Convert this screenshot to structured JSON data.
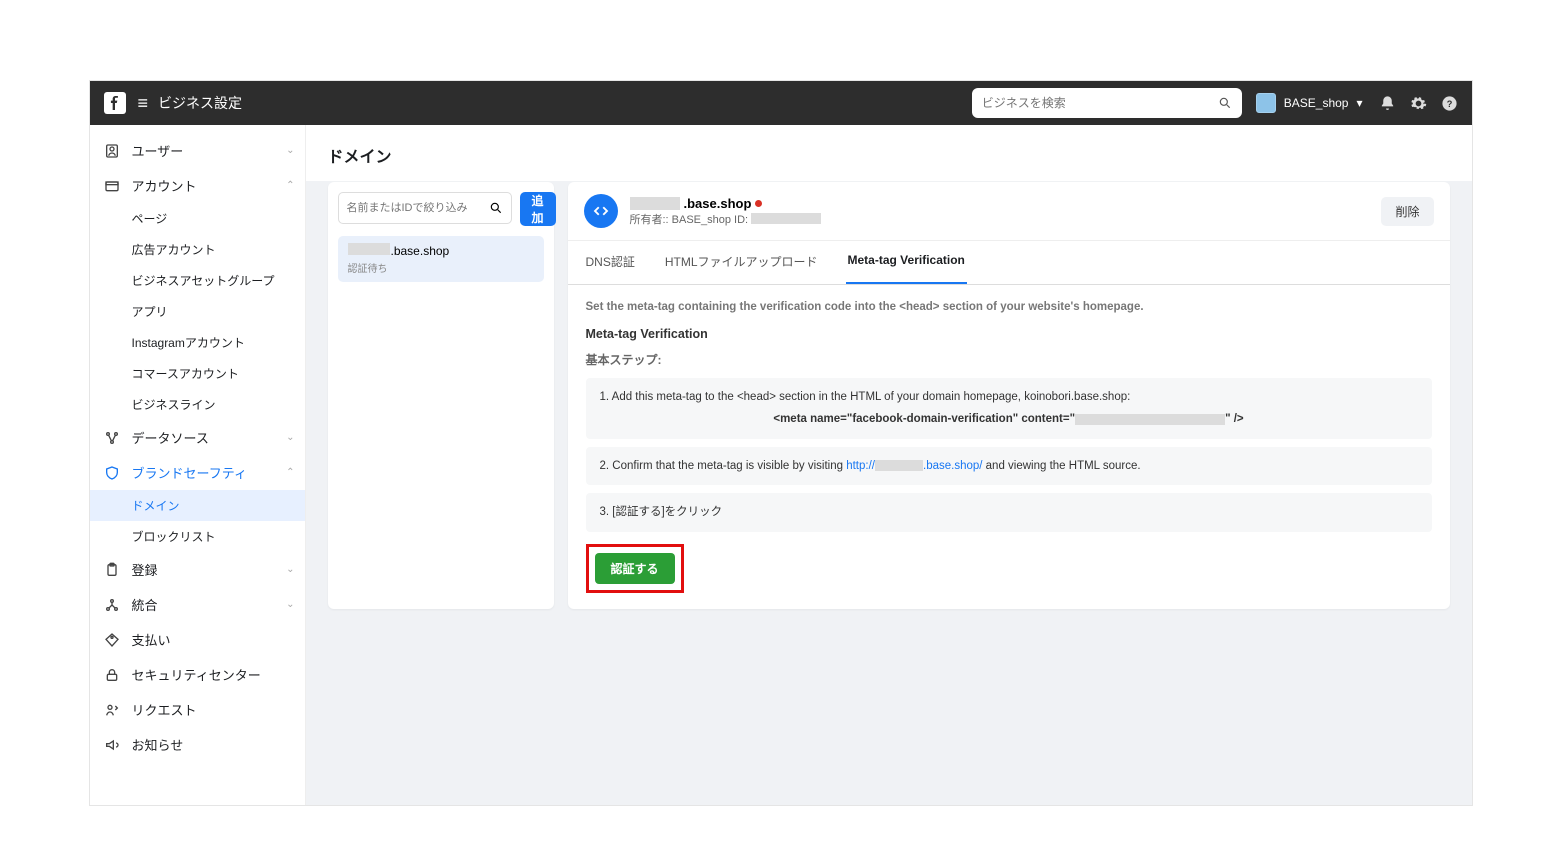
{
  "topbar": {
    "title": "ビジネス設定",
    "search_placeholder": "ビジネスを検索",
    "account_name": "BASE_shop"
  },
  "sidebar": {
    "users": "ユーザー",
    "accounts": "アカウント",
    "accounts_sub": {
      "pages": "ページ",
      "ad_accounts": "広告アカウント",
      "biz_asset_groups": "ビジネスアセットグループ",
      "apps": "アプリ",
      "instagram": "Instagramアカウント",
      "commerce": "コマースアカウント",
      "biz_lines": "ビジネスライン"
    },
    "data_sources": "データソース",
    "brand_safety": "ブランドセーフティ",
    "brand_safety_sub": {
      "domains": "ドメイン",
      "blocklists": "ブロックリスト"
    },
    "registrations": "登録",
    "integrations": "統合",
    "billing": "支払い",
    "security": "セキュリティセンター",
    "requests": "リクエスト",
    "notifications": "お知らせ"
  },
  "main": {
    "title": "ドメイン",
    "list": {
      "search_placeholder": "名前またはIDで絞り込み",
      "add_button": "追加",
      "item_domain_suffix": ".base.shop",
      "item_status": "認証待ち"
    },
    "detail": {
      "domain_suffix": ".base.shop",
      "owner_prefix": "所有者:: BASE_shop  ID:",
      "delete_button": "削除",
      "tabs": {
        "dns": "DNS認証",
        "html_upload": "HTMLファイルアップロード",
        "meta_tag": "Meta-tag Verification"
      },
      "desc": "Set the meta-tag containing the verification code into the <head> section of your website's homepage.",
      "section_title": "Meta-tag Verification",
      "steps_title": "基本ステップ:",
      "step1_text": "1. Add this meta-tag to the <head> section in the HTML of your domain homepage, koinobori.base.shop:",
      "step1_code_prefix": "<meta name=\"facebook-domain-verification\" content=\"",
      "step1_code_suffix": "\" />",
      "step2_prefix": "2. Confirm that the meta-tag is visible by visiting ",
      "step2_link_prefix": "http://",
      "step2_link_suffix": ".base.shop/",
      "step2_suffix": " and viewing the HTML source.",
      "step3": "3. [認証する]をクリック",
      "verify_button": "認証する"
    }
  }
}
